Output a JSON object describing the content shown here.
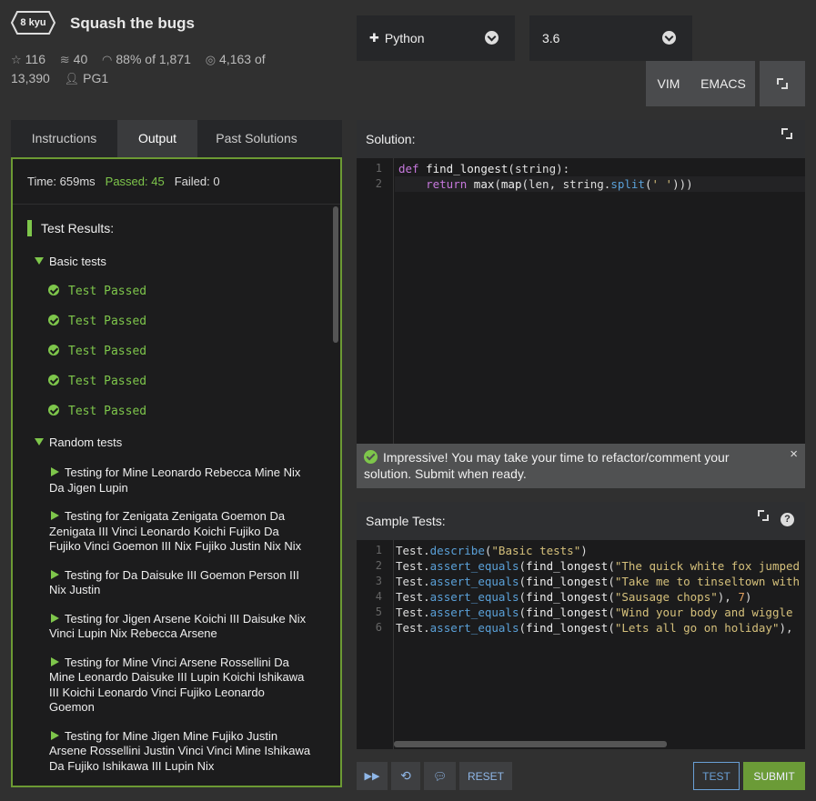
{
  "kata": {
    "rank": "8 kyu",
    "title": "Squash the bugs"
  },
  "stats": {
    "stars": "116",
    "collections": "40",
    "satisfaction": "88%",
    "satisfaction_of": "of",
    "satisfaction_votes": "1,871",
    "completed": "4,163",
    "completed_of": "of",
    "attempts": "13,390",
    "author": "PG1"
  },
  "language_select": {
    "value": "Python",
    "icon": "python-icon"
  },
  "version_select": {
    "value": "3.6"
  },
  "editor_modes": {
    "vim": "VIM",
    "emacs": "EMACS"
  },
  "tabs": [
    {
      "label": "Instructions",
      "active": false
    },
    {
      "label": "Output",
      "active": true
    },
    {
      "label": "Past Solutions",
      "active": false
    }
  ],
  "output": {
    "time": "Time: 659ms",
    "passed": "Passed: 45",
    "failed": "Failed: 0",
    "results_heading": "Test Results:",
    "basic_group": "Basic tests",
    "basic_results": [
      "Test Passed",
      "Test Passed",
      "Test Passed",
      "Test Passed",
      "Test Passed"
    ],
    "random_group": "Random tests",
    "random_results": [
      "Testing for Mine Leonardo Rebecca Mine Nix Da Jigen Lupin",
      "Testing for Zenigata Zenigata Goemon Da Zenigata III Vinci Leonardo Koichi Fujiko Da Fujiko Vinci Goemon III Nix Fujiko Justin Nix Nix",
      "Testing for Da Daisuke III Goemon Person III Nix Justin",
      "Testing for Jigen Arsene Koichi III Daisuke Nix Vinci Lupin Nix Rebecca Arsene",
      "Testing for Mine Vinci Arsene Rossellini Da Mine Leonardo Daisuke III Lupin Koichi Ishikawa III Koichi Leonardo Vinci Fujiko Leonardo Goemon",
      "Testing for Mine Jigen Mine Fujiko Justin Arsene Rossellini Justin Vinci Vinci Mine Ishikawa Da Fujiko Ishikawa III Lupin Nix"
    ]
  },
  "solution": {
    "heading": "Solution:",
    "line_numbers": [
      "1",
      "2"
    ],
    "lines": [
      "def find_longest(string):",
      "    return max(map(len, string.split(' ')))"
    ]
  },
  "notice": {
    "text": "Impressive! You may take your time to refactor/comment your solution. Submit when ready.",
    "close": "×"
  },
  "sample_tests": {
    "heading": "Sample Tests:",
    "help": "?",
    "line_numbers": [
      "1",
      "2",
      "3",
      "4",
      "5",
      "6"
    ],
    "lines": [
      "Test.describe(\"Basic tests\")",
      "Test.assert_equals(find_longest(\"The quick white fox jumped",
      "Test.assert_equals(find_longest(\"Take me to tinseltown with",
      "Test.assert_equals(find_longest(\"Sausage chops\"), 7)",
      "Test.assert_equals(find_longest(\"Wind your body and wiggle",
      "Test.assert_equals(find_longest(\"Lets all go on holiday\"),"
    ]
  },
  "footer": {
    "reset": "RESET",
    "test": "TEST",
    "submit": "SUBMIT"
  },
  "colors": {
    "accent_green": "#7ec64b",
    "submit_green": "#6b9b37",
    "test_blue": "#6aa0d6",
    "background": "#303030"
  }
}
